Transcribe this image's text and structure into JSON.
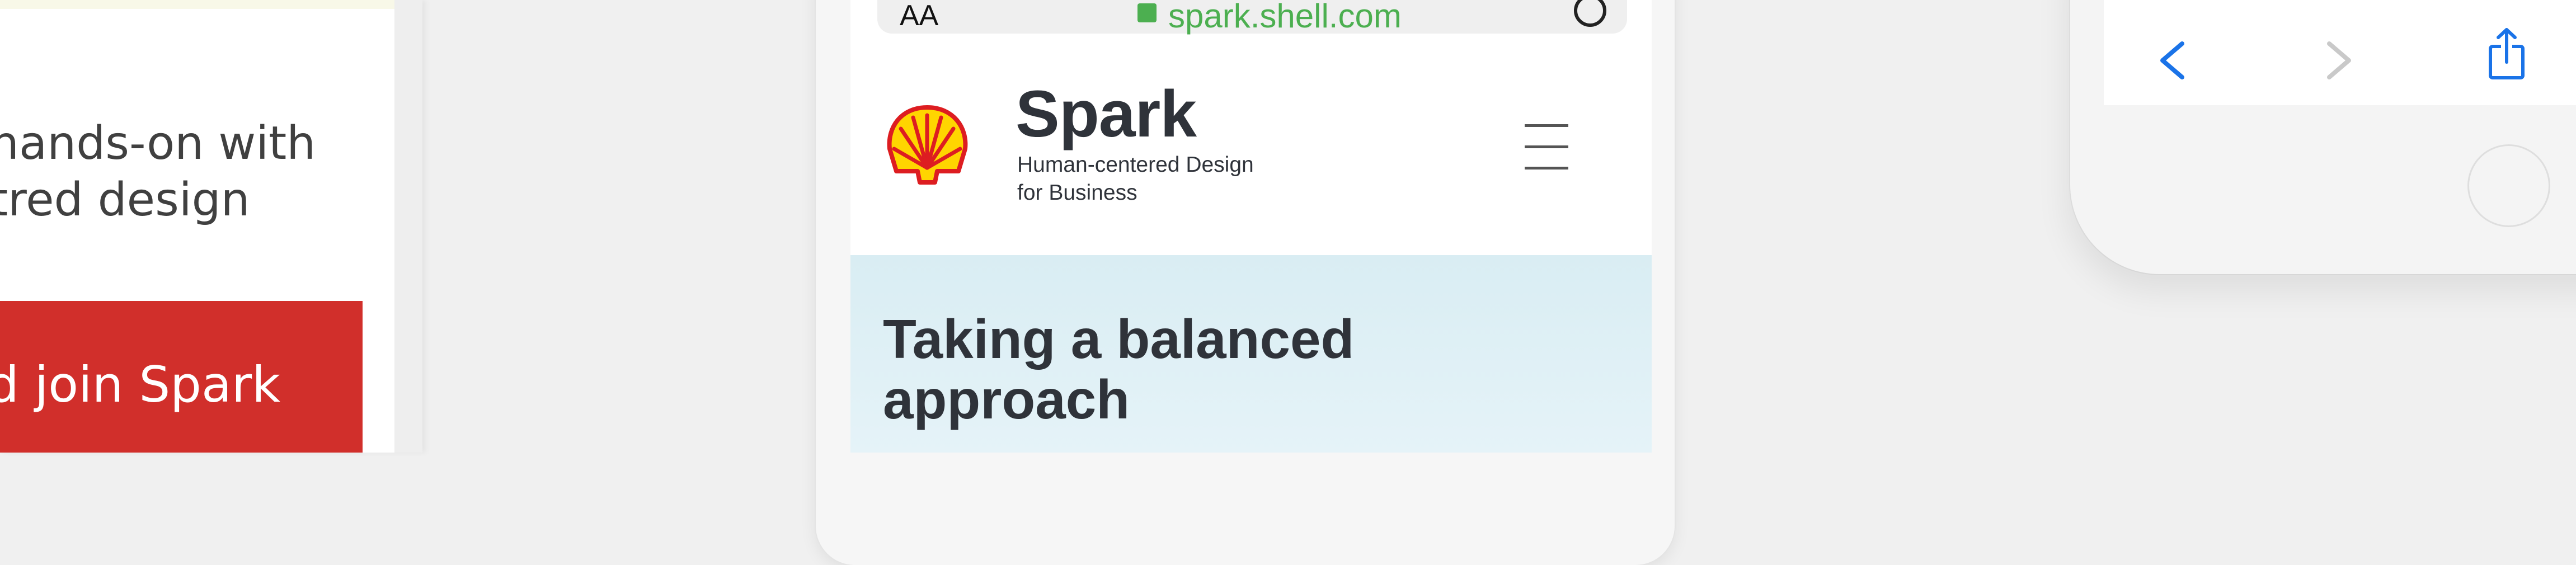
{
  "left_phone": {
    "copy": "hands-on with\ntred design",
    "cta_label": "d join Spark",
    "cta_color": "#d12f2b"
  },
  "browser": {
    "aa_label": "AA",
    "url": "spark.shell.com",
    "url_color": "#4caf50",
    "reload_icon": "reload-icon"
  },
  "site": {
    "brand": "Spark",
    "tagline": "Human-centered Design\nfor Business",
    "logo_icon": "shell-logo-icon",
    "menu_icon": "hamburger-menu-icon",
    "hero_title": "Taking a balanced\napproach",
    "hero_bg": "#e0f0f5",
    "text_color": "#2f333a"
  },
  "right_phone": {
    "nav_icons": [
      "back-icon",
      "forward-icon",
      "share-icon"
    ],
    "accent": "#1a73e8"
  }
}
